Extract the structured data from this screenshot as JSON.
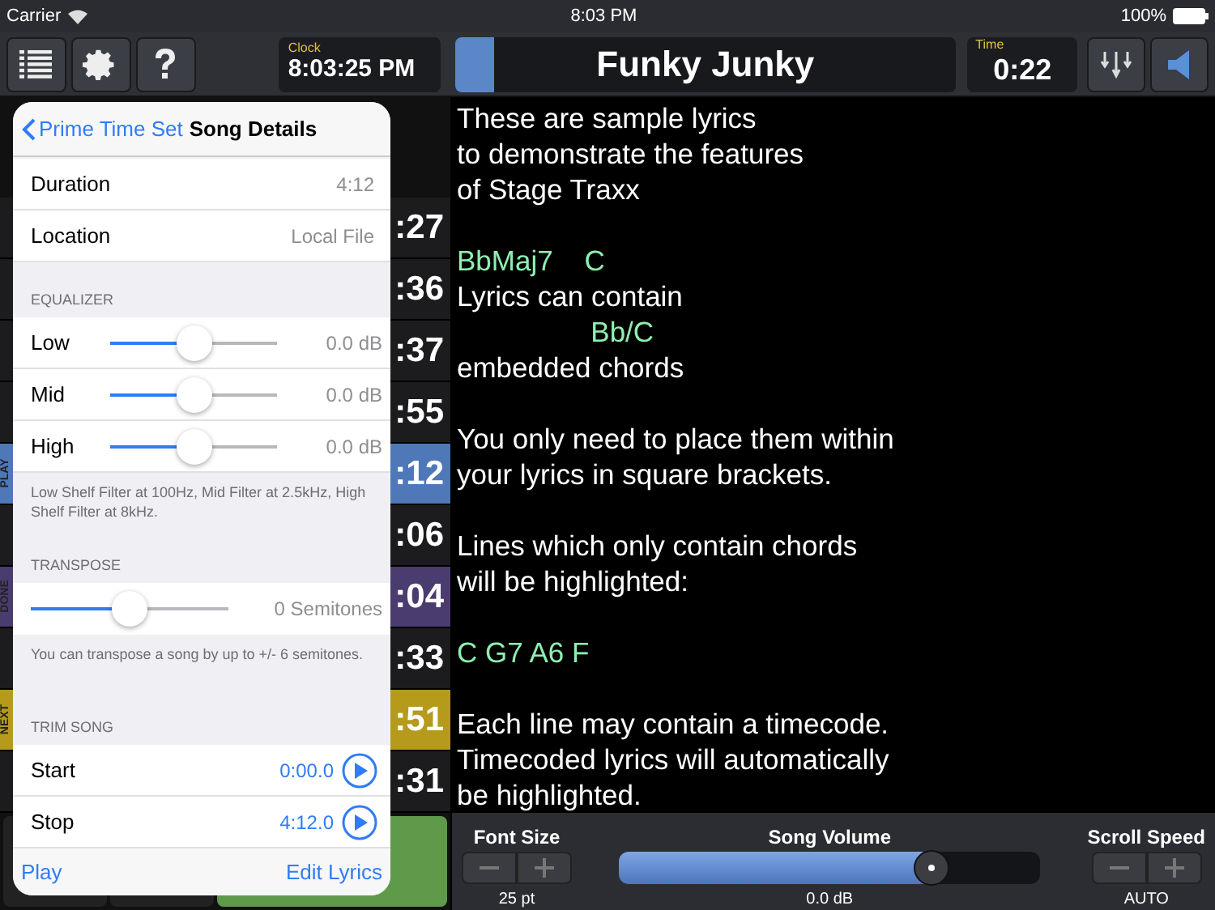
{
  "status_bar": {
    "carrier": "Carrier",
    "time": "8:03 PM",
    "battery": "100%"
  },
  "toolbar": {
    "clock_label": "Clock",
    "clock": "8:03:25 PM",
    "song_title": "Funky Junky",
    "song_progress": {
      "level": 0.08
    },
    "time_label": "Time",
    "time": "0:22"
  },
  "song_list": [
    {
      "time": ":27",
      "kind": "plain"
    },
    {
      "time": ":36",
      "kind": "plain"
    },
    {
      "time": ":37",
      "kind": "plain"
    },
    {
      "time": ":55",
      "kind": "plain"
    },
    {
      "time": ":12",
      "kind": "play",
      "tag": "PLAY"
    },
    {
      "time": ":06",
      "kind": "plain"
    },
    {
      "time": ":04",
      "kind": "done",
      "tag": "DONE"
    },
    {
      "time": ":33",
      "kind": "plain"
    },
    {
      "time": ":51",
      "kind": "next",
      "tag": "NEXT"
    },
    {
      "time": ":31",
      "kind": "plain"
    }
  ],
  "popover": {
    "back": "Prime Time Set",
    "title": "Song Details",
    "info": [
      {
        "label": "Duration",
        "value": "4:12"
      },
      {
        "label": "Location",
        "value": "Local File"
      }
    ],
    "equalizer": {
      "header": "EQUALIZER",
      "bands": [
        {
          "label": "Low",
          "level": 0.5,
          "reading": "0.0 dB"
        },
        {
          "label": "Mid",
          "level": 0.5,
          "reading": "0.0 dB"
        },
        {
          "label": "High",
          "level": 0.5,
          "reading": "0.0 dB"
        }
      ],
      "note": "Low Shelf Filter at 100Hz, Mid Filter at 2.5kHz, High Shelf Filter at 8kHz."
    },
    "transpose": {
      "header": "TRANSPOSE",
      "level": 0.5,
      "reading": "0 Semitones",
      "note": "You can transpose a song by up to +/- 6 semitones."
    },
    "trim": {
      "header": "TRIM SONG",
      "rows": [
        {
          "label": "Start",
          "value": "0:00.0"
        },
        {
          "label": "Stop",
          "value": "4:12.0"
        }
      ]
    },
    "footer": {
      "left": "Play",
      "right": "Edit Lyrics"
    }
  },
  "lyrics": [
    {
      "kind": "text",
      "text": "These are sample lyrics"
    },
    {
      "kind": "text",
      "text": "to demonstrate the features"
    },
    {
      "kind": "text",
      "text": "of Stage Traxx"
    },
    {
      "kind": "blank"
    },
    {
      "kind": "chord",
      "text": "BbMaj7    C"
    },
    {
      "kind": "text",
      "text": "Lyrics can contain"
    },
    {
      "kind": "chord",
      "text": "                 Bb/C"
    },
    {
      "kind": "text",
      "text": "embedded chords"
    },
    {
      "kind": "blank"
    },
    {
      "kind": "text",
      "text": "You only need to place them within"
    },
    {
      "kind": "text",
      "text": "your lyrics in square brackets."
    },
    {
      "kind": "blank"
    },
    {
      "kind": "text",
      "text": "Lines which only contain chords"
    },
    {
      "kind": "text",
      "text": "will be highlighted:"
    },
    {
      "kind": "blank"
    },
    {
      "kind": "chord",
      "text": "C G7 A6 F"
    },
    {
      "kind": "blank"
    },
    {
      "kind": "text",
      "text": "Each line may contain a timecode."
    },
    {
      "kind": "text",
      "text": "Timecoded lyrics will automatically"
    },
    {
      "kind": "text",
      "text": "be highlighted."
    }
  ],
  "controls": {
    "font_size": {
      "label": "Font Size",
      "value": "25 pt"
    },
    "volume": {
      "label": "Song Volume",
      "level": 0.74,
      "reading": "0.0 dB"
    },
    "scroll_speed": {
      "label": "Scroll Speed",
      "value": "AUTO"
    }
  }
}
